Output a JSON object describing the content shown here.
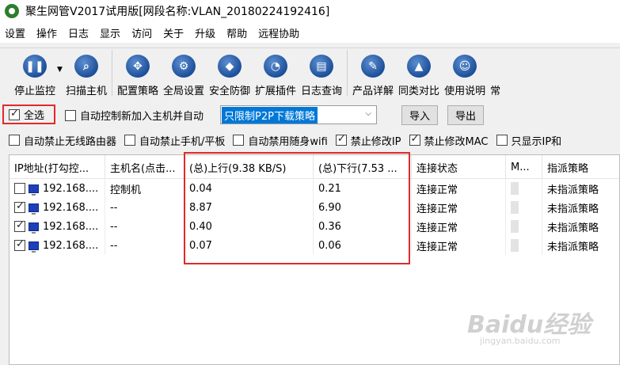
{
  "window": {
    "title": "聚生网管V2017试用版[网段名称:VLAN_20180224192416]"
  },
  "menu": [
    "设置",
    "操作",
    "日志",
    "显示",
    "访问",
    "关于",
    "升级",
    "帮助",
    "远程协助"
  ],
  "toolbar": {
    "stop_monitor": "停止监控",
    "scan_host": "扫描主机",
    "config_strategy": "配置策略",
    "global_settings": "全局设置",
    "security_defense": "安全防御",
    "extensions": "扩展插件",
    "log_query": "日志查询",
    "product_detail": "产品详解",
    "compare": "同类对比",
    "usage": "使用说明",
    "more": "常"
  },
  "controls": {
    "select_all": "全选",
    "auto_control_label": "自动控制新加入主机并自动",
    "strategy_value": "只限制P2P下载策略",
    "import_button": "导入",
    "export_button": "导出"
  },
  "options": [
    {
      "label": "自动禁止无线路由器",
      "checked": false
    },
    {
      "label": "自动禁止手机/平板",
      "checked": false
    },
    {
      "label": "自动禁用随身wifi",
      "checked": false
    },
    {
      "label": "禁止修改IP",
      "checked": true
    },
    {
      "label": "禁止修改MAC",
      "checked": true
    },
    {
      "label": "只显示IP和",
      "checked": false
    }
  ],
  "table": {
    "columns": [
      "IP地址(打勾控...",
      "主机名(点击...",
      "(总)上行(9.38 KB/S)",
      "(总)下行(7.53 ...",
      "连接状态",
      "M...",
      "指派策略"
    ],
    "rows": [
      {
        "checked": false,
        "ip": "192.168....",
        "host": "控制机",
        "up": "0.04",
        "down": "0.21",
        "status": "连接正常",
        "policy": "未指派策略"
      },
      {
        "checked": true,
        "ip": "192.168....",
        "host": "--",
        "up": "8.87",
        "down": "6.90",
        "status": "连接正常",
        "policy": "未指派策略"
      },
      {
        "checked": true,
        "ip": "192.168....",
        "host": "--",
        "up": "0.40",
        "down": "0.36",
        "status": "连接正常",
        "policy": "未指派策略"
      },
      {
        "checked": true,
        "ip": "192.168....",
        "host": "--",
        "up": "0.07",
        "down": "0.06",
        "status": "连接正常",
        "policy": "未指派策略"
      }
    ]
  },
  "watermark": {
    "brand": "Baidu经验",
    "url": "jingyan.baidu.com"
  }
}
